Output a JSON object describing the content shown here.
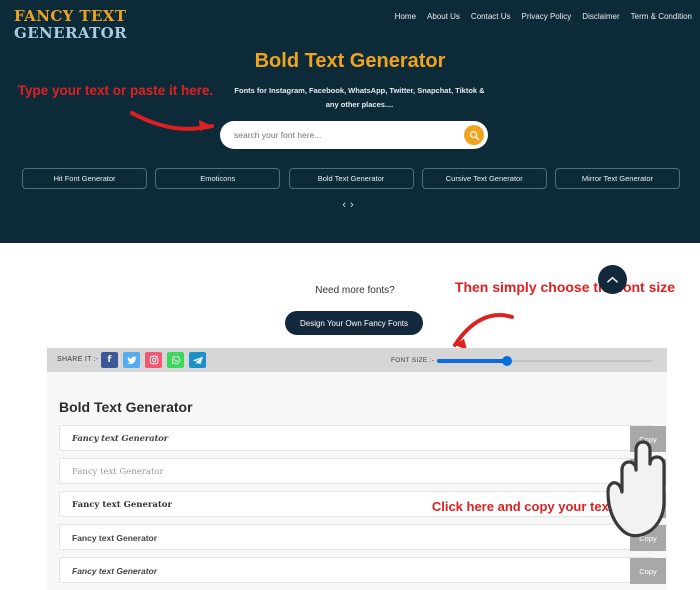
{
  "header": {
    "logo_line1": "FANCY TEXT",
    "logo_line2": "GENERATOR",
    "nav": [
      {
        "label": "Home"
      },
      {
        "label": "About Us"
      },
      {
        "label": "Contact Us"
      },
      {
        "label": "Privacy Policy"
      },
      {
        "label": "Disclaimer"
      },
      {
        "label": "Term & Condition"
      }
    ]
  },
  "hero": {
    "title": "Bold Text Generator",
    "subtitle": "Fonts for Instagram, Facebook, WhatsApp, Twitter, Snapchat, Tiktok & any other places....",
    "search_placeholder": "search your font here...",
    "search_value": "",
    "search_icon": "search-icon",
    "categories": [
      {
        "label": "Hit Font Generator"
      },
      {
        "label": "Emoticons"
      },
      {
        "label": "Bold Text Generator"
      },
      {
        "label": "Cursive Text Generator"
      },
      {
        "label": "Mirror Text Generator"
      }
    ],
    "carousel_prev": "‹",
    "carousel_next": "›"
  },
  "annotations": [
    {
      "text": "Type your text or paste it here."
    },
    {
      "text": "Then simply choose the font size"
    },
    {
      "text": "Click here and copy your text"
    }
  ],
  "middle": {
    "need_more_fonts": "Need more fonts?",
    "design_button": "Design Your Own Fancy Fonts",
    "scroll_top_icon": "chevron-up-icon"
  },
  "toolbar": {
    "share_label": "SHARE IT :-",
    "socials": [
      {
        "name": "facebook-icon",
        "glyph": "f",
        "color": "#3b5998"
      },
      {
        "name": "twitter-icon",
        "glyph": "❈",
        "color": "#55acee"
      },
      {
        "name": "instagram-icon",
        "glyph": "▣",
        "color": "#ef5a72"
      },
      {
        "name": "whatsapp-icon",
        "glyph": "✆",
        "color": "#3bd85c"
      },
      {
        "name": "telegram-icon",
        "glyph": "➤",
        "color": "#1d8fc9"
      }
    ],
    "font_size_label": "FONT SIZE :-",
    "font_size_percent": 33
  },
  "panel": {
    "title": "Bold Text Generator",
    "copy_label": "Copy",
    "rows": [
      {
        "text": "Fancy text Generator",
        "style": "f-fraktur"
      },
      {
        "text": "Fancy text Generator",
        "style": "f-serif-light"
      },
      {
        "text": "Fancy text Generator",
        "style": "f-serif-bold"
      },
      {
        "text": "Fancy text Generator",
        "style": "f-sans-bold"
      },
      {
        "text": "Fancy text Generator",
        "style": "f-sans-bold-italic"
      }
    ]
  },
  "colors": {
    "hero_bg": "#0c2a37",
    "accent_orange": "#f0a41e",
    "logo_blue": "#a9cde0",
    "annotation_red": "#e02020",
    "slider_blue": "#0a6ce0",
    "toolbar_bg": "#d6d6d6",
    "panel_bg": "#f7f7f7",
    "copy_btn_bg": "#a8a8a8"
  }
}
